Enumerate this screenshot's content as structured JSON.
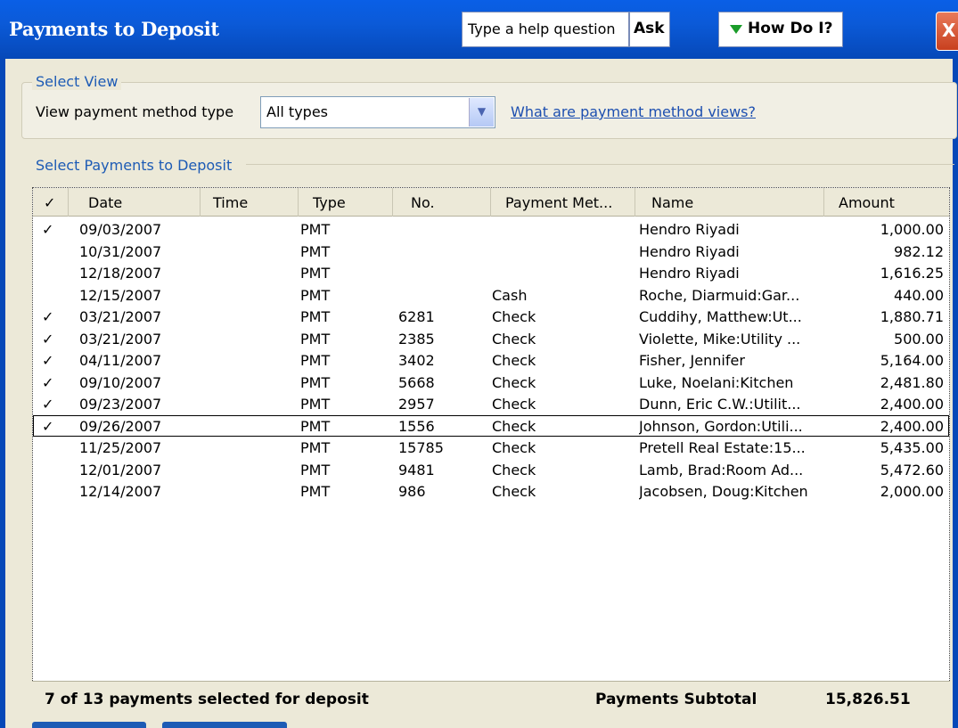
{
  "window": {
    "title": "Payments to Deposit",
    "help_placeholder": "Type a help question",
    "ask_label": "Ask",
    "howdo_label": "How Do I?",
    "close_label": "X"
  },
  "select_view": {
    "legend": "Select View",
    "label": "View payment method type",
    "selected": "All types",
    "link": "What are payment method views?"
  },
  "payments": {
    "legend": "Select Payments to Deposit",
    "columns": [
      "✓",
      "Date",
      "Time",
      "Type",
      "No.",
      "Payment Met...",
      "Name",
      "Amount"
    ],
    "rows": [
      {
        "check": "✓",
        "date": "09/03/2007",
        "type": "PMT",
        "no": "",
        "method": "",
        "name": "Hendro Riyadi",
        "amount": "1,000.00"
      },
      {
        "check": "",
        "date": "10/31/2007",
        "type": "PMT",
        "no": "",
        "method": "",
        "name": "Hendro Riyadi",
        "amount": "982.12"
      },
      {
        "check": "",
        "date": "12/18/2007",
        "type": "PMT",
        "no": "",
        "method": "",
        "name": "Hendro Riyadi",
        "amount": "1,616.25"
      },
      {
        "check": "",
        "date": "12/15/2007",
        "type": "PMT",
        "no": "",
        "method": "Cash",
        "name": "Roche, Diarmuid:Gar...",
        "amount": "440.00"
      },
      {
        "check": "✓",
        "date": "03/21/2007",
        "type": "PMT",
        "no": "6281",
        "method": "Check",
        "name": "Cuddihy, Matthew:Ut...",
        "amount": "1,880.71"
      },
      {
        "check": "✓",
        "date": "03/21/2007",
        "type": "PMT",
        "no": "2385",
        "method": "Check",
        "name": "Violette, Mike:Utility ...",
        "amount": "500.00"
      },
      {
        "check": "✓",
        "date": "04/11/2007",
        "type": "PMT",
        "no": "3402",
        "method": "Check",
        "name": "Fisher, Jennifer",
        "amount": "5,164.00"
      },
      {
        "check": "✓",
        "date": "09/10/2007",
        "type": "PMT",
        "no": "5668",
        "method": "Check",
        "name": "Luke, Noelani:Kitchen",
        "amount": "2,481.80"
      },
      {
        "check": "✓",
        "date": "09/23/2007",
        "type": "PMT",
        "no": "2957",
        "method": "Check",
        "name": "Dunn, Eric C.W.:Utilit...",
        "amount": "2,400.00"
      },
      {
        "check": "✓",
        "date": "09/26/2007",
        "type": "PMT",
        "no": "1556",
        "method": "Check",
        "name": "Johnson, Gordon:Utili...",
        "amount": "2,400.00"
      },
      {
        "check": "",
        "date": "11/25/2007",
        "type": "PMT",
        "no": "15785",
        "method": "Check",
        "name": "Pretell Real Estate:15...",
        "amount": "5,435.00"
      },
      {
        "check": "",
        "date": "12/01/2007",
        "type": "PMT",
        "no": "9481",
        "method": "Check",
        "name": "Lamb, Brad:Room Ad...",
        "amount": "5,472.60"
      },
      {
        "check": "",
        "date": "12/14/2007",
        "type": "PMT",
        "no": "986",
        "method": "Check",
        "name": "Jacobsen, Doug:Kitchen",
        "amount": "2,000.00"
      }
    ],
    "footer_status": "7 of 13 payments selected for deposit",
    "subtotal_label": "Payments Subtotal",
    "subtotal_value": "15,826.51"
  }
}
